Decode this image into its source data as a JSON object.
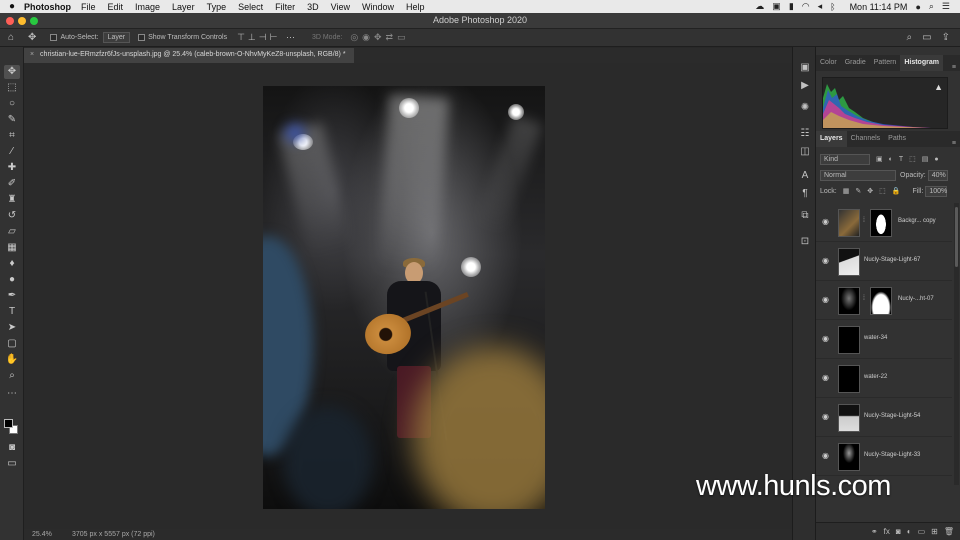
{
  "menubar": {
    "app_name": "Photoshop",
    "menus": [
      "File",
      "Edit",
      "Image",
      "Layer",
      "Type",
      "Select",
      "Filter",
      "3D",
      "View",
      "Window",
      "Help"
    ],
    "clock": "Mon 11:14 PM"
  },
  "window": {
    "title": "Adobe Photoshop 2020"
  },
  "options": {
    "auto_select_label": "Auto-Select:",
    "auto_select_value": "Layer",
    "transform_label": "Show Transform Controls",
    "mode_3d": "3D Mode:"
  },
  "document": {
    "tab_title": "christian-lue-ERmzfzr6fJs-unsplash.jpg @ 25.4% (caleb-brown-O-NhvMyKeZ8-unsplash, RGB/8) *",
    "close": "×"
  },
  "status": {
    "zoom": "25.4%",
    "dimensions": "3705 px x 5557 px (72 ppi)"
  },
  "panels": {
    "top_tabs": [
      "Color",
      "Gradie",
      "Pattern",
      "Histogram"
    ],
    "active_top_tab": "Histogram",
    "layer_tabs": [
      "Layers",
      "Channels",
      "Paths"
    ],
    "kind_value": "Kind",
    "blend_mode": "Normal",
    "opacity_label": "Opacity:",
    "opacity_value": "40%",
    "lock_label": "Lock:",
    "fill_label": "Fill:",
    "fill_value": "100%"
  },
  "layers": [
    {
      "name": "Backgr... copy"
    },
    {
      "name": "Nucly-Stage-Light-67"
    },
    {
      "name": "Nucly-...ht-07"
    },
    {
      "name": "water-34"
    },
    {
      "name": "water-22"
    },
    {
      "name": "Nucly-Stage-Light-54"
    },
    {
      "name": "Nucly-Stage-Light-33"
    }
  ],
  "watermark": "www.hunls.com",
  "icons": {
    "apple": "apple-icon",
    "home": "home-icon",
    "move": "move-icon",
    "eye": "eye-icon",
    "warning": "warning-icon"
  }
}
